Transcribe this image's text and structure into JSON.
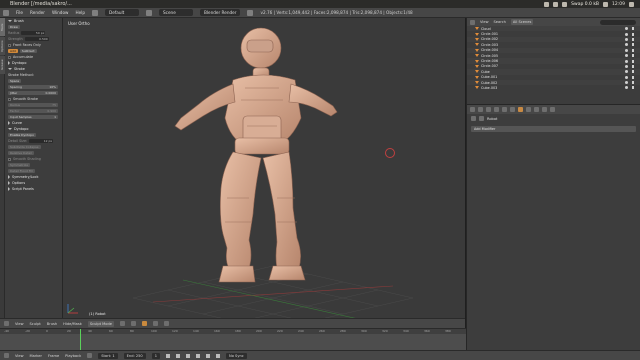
{
  "os_bar": {
    "title": "Blender [/media/sakro/...",
    "sound_label": "Swap 0.0 kB",
    "clock": "12:09"
  },
  "info_bar": {
    "menus": [
      "File",
      "Render",
      "Window",
      "Help"
    ],
    "screen_layout": "Default",
    "scene": "Scene",
    "render_engine": "Blender Render",
    "stats": "v2.76 | Verts:1,049,442 | Faces:2,098,874 | Tris:2,098,874 | Objects:1/48"
  },
  "tool_shelf": {
    "tabs": [
      "Tools",
      "Options",
      "Grease Pencil"
    ],
    "sections": [
      {
        "kind": "head",
        "label": "Brush"
      },
      {
        "kind": "field",
        "label": "Dyntopo"
      },
      {
        "kind": "head",
        "label": "Dyntopo"
      },
      {
        "kind": "head",
        "label": "Stroke"
      },
      {
        "kind": "head",
        "label": "Curve"
      },
      {
        "kind": "head",
        "label": "Symmetry/Lock"
      },
      {
        "kind": "head",
        "label": "Options"
      }
    ],
    "brush": "Draw",
    "radius_label": "Radius",
    "radius_value": "50 px",
    "strength_label": "Strength",
    "strength_value": "0.500",
    "add_label": "Add",
    "subtract_label": "Subtract",
    "front_faces_label": "Front Faces Only",
    "accumulate_label": "Accumulate",
    "stroke_method_label": "Stroke Method:",
    "stroke_method_value": "Space",
    "spacing_label": "Spacing",
    "spacing_value": "10%",
    "jitter_label": "Jitter",
    "jitter_value": "0.0000",
    "smooth_stroke_label": "Smooth Stroke",
    "radius2_label": "Radius",
    "radius2_value": "75",
    "factor_label": "Factor",
    "factor_value": "0.900",
    "input_samples_label": "Input Samples",
    "input_samples_value": "1",
    "enable_dyntopo_label": "Enable Dyntopo",
    "detail_size_label": "Detail Size:",
    "detail_size_value": "12 px",
    "subdivide_label": "Subdivide Collapse",
    "relative_detail_label": "Relative Detail",
    "smooth_shading_label": "Smooth Shading",
    "symmetrize_label": "Symmetrize",
    "detail_flood_label": "Detail Flood Fill",
    "script_panel": "Script Panels"
  },
  "viewport": {
    "view_label": "User Ortho",
    "object_label": "(1) Robot"
  },
  "viewport_header": {
    "items": [
      "View",
      "Sculpt",
      "Brush",
      "Hide/Mask",
      "Sculpt Mode"
    ]
  },
  "timeline": {
    "ticks": [
      "-40",
      "-20",
      "0",
      "20",
      "40",
      "60",
      "80",
      "100",
      "120",
      "140",
      "160",
      "180",
      "200",
      "220",
      "240",
      "260",
      "280",
      "300",
      "320",
      "340",
      "360",
      "380",
      "400",
      "420",
      "440",
      "460",
      "480",
      "500",
      "520",
      "540",
      "560"
    ],
    "menus": [
      "View",
      "Marker",
      "Frame",
      "Playback"
    ],
    "start_label": "Start:",
    "start_value": "1",
    "end_label": "End:",
    "end_value": "250",
    "current_frame": "1",
    "sync": "No Sync"
  },
  "outliner": {
    "menus": [
      "View",
      "Search"
    ],
    "scope": "All Scenes",
    "items": [
      "Cloud",
      "Circle.001",
      "Circle.002",
      "Circle.003",
      "Circle.004",
      "Circle.005",
      "Circle.006",
      "Circle.007",
      "Cube",
      "Cube.001",
      "Cube.002",
      "Cube.003"
    ]
  },
  "properties": {
    "context_object": "Robot",
    "add_modifier_label": "Add Modifier"
  },
  "colors": {
    "accent": "#d28a3a",
    "viewport_bg": "#3a3a3a",
    "model": "#d7a990"
  }
}
